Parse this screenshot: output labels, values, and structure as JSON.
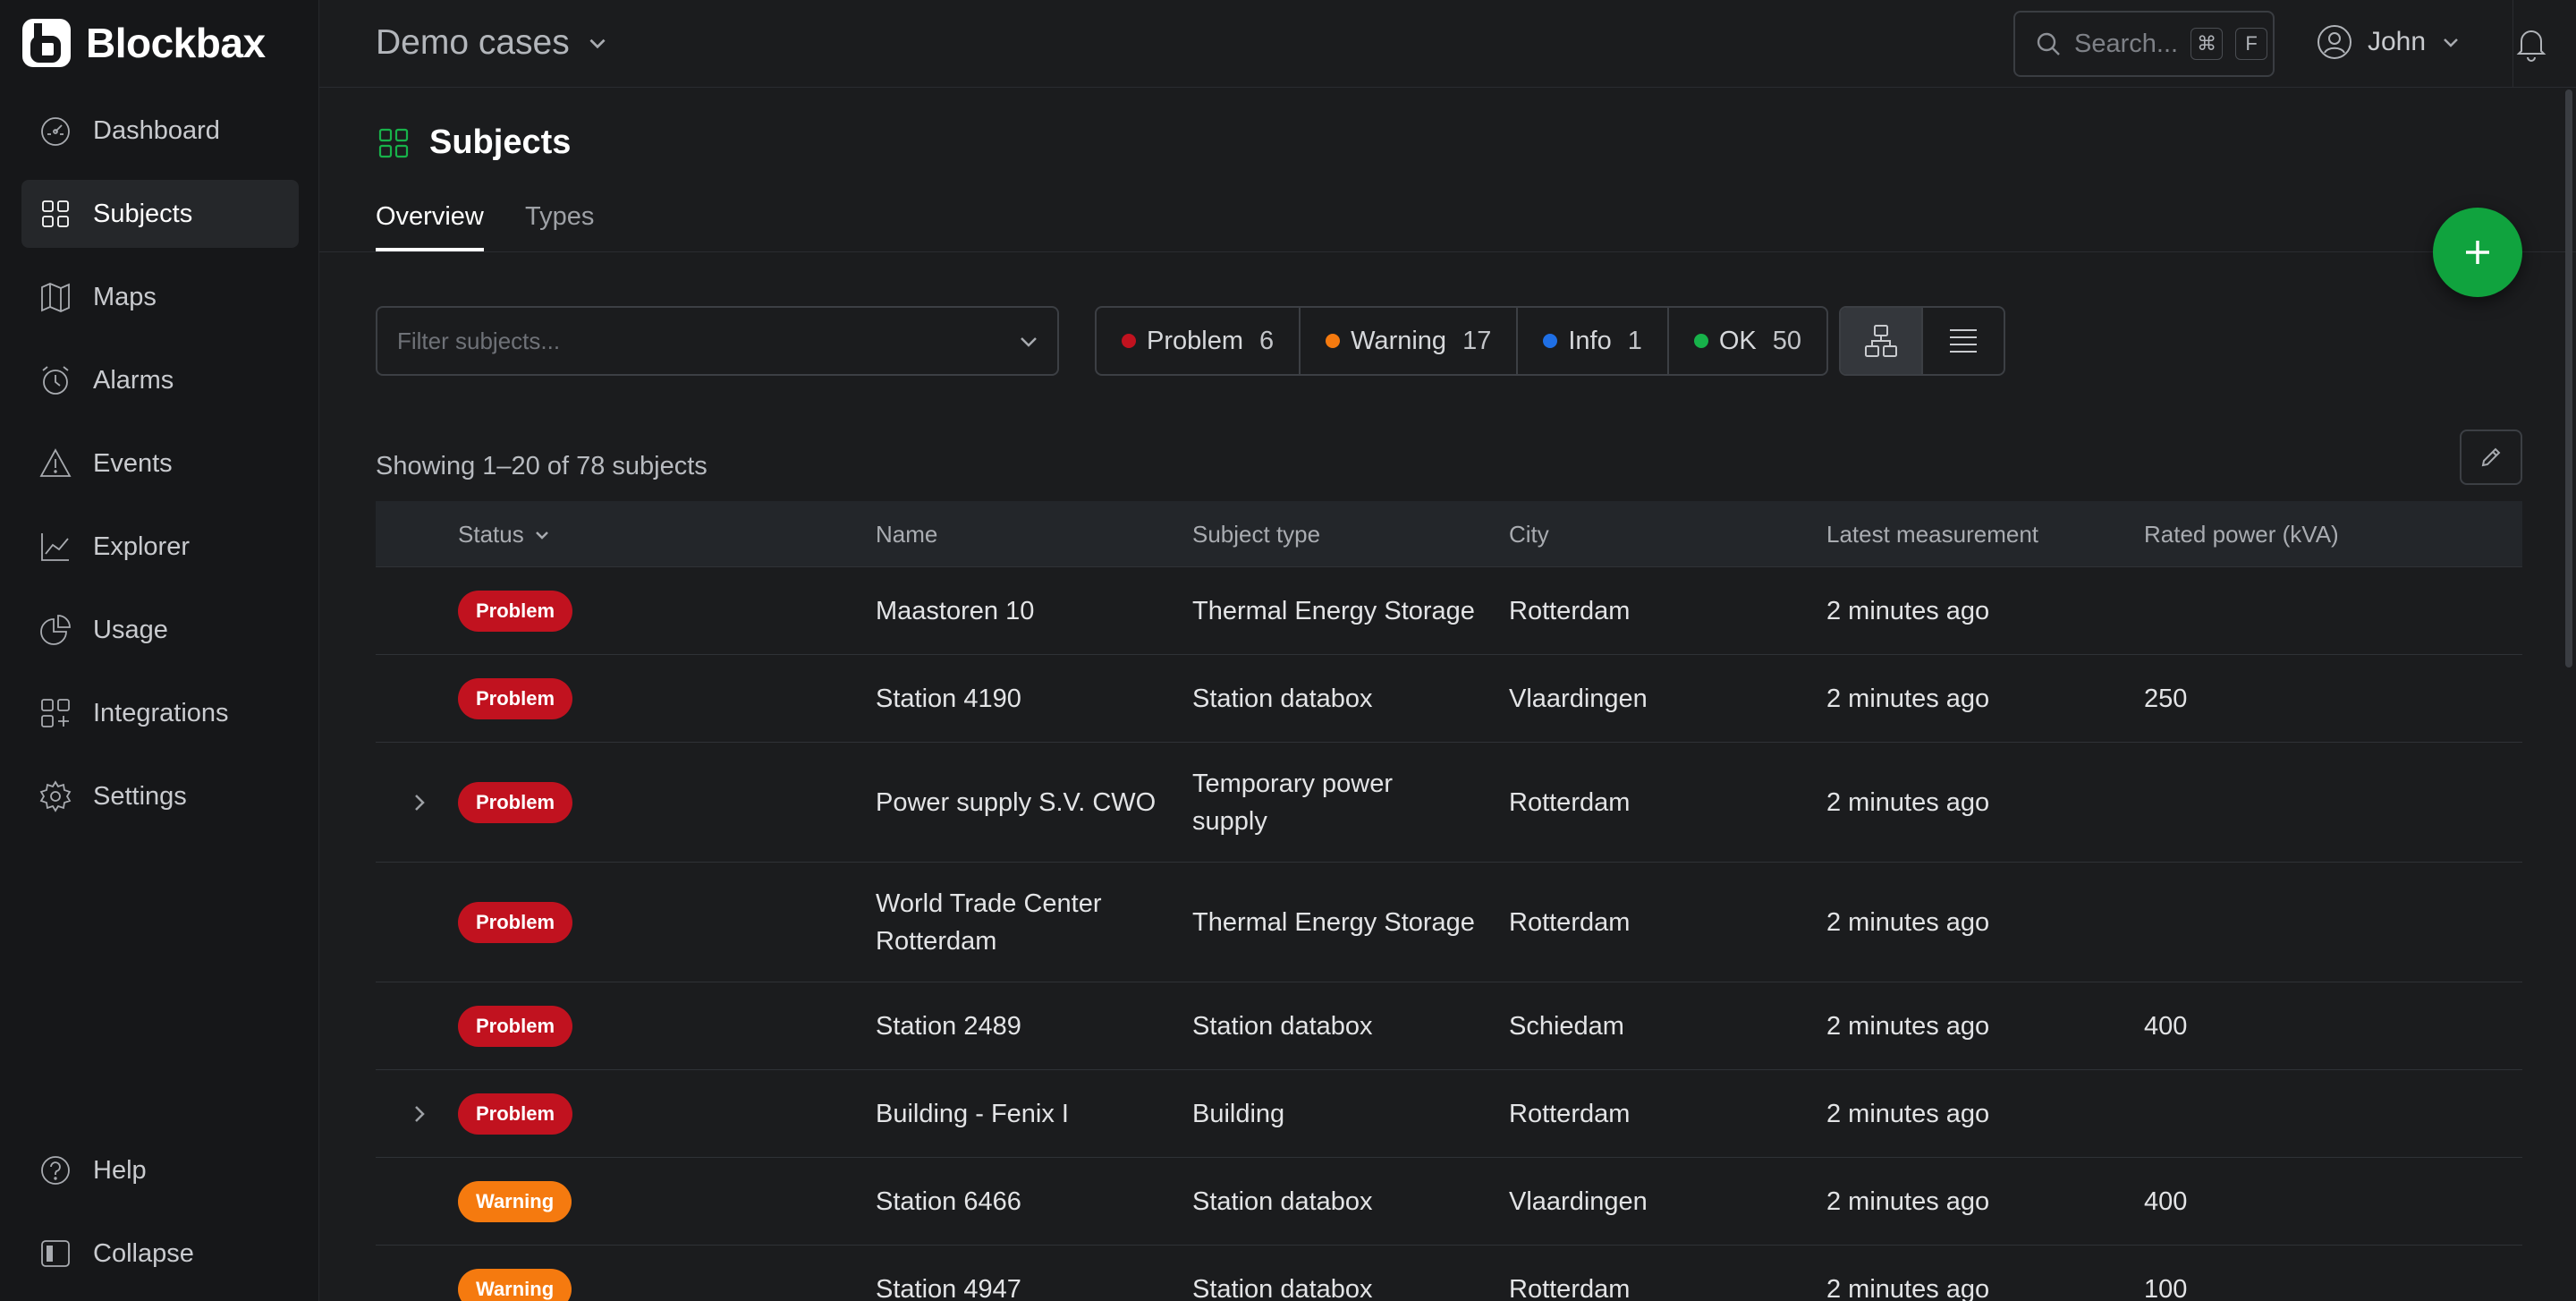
{
  "brand": {
    "name": "Blockbax"
  },
  "sidebar": {
    "items": [
      {
        "label": "Dashboard",
        "icon": "dashboard-icon",
        "active": false
      },
      {
        "label": "Subjects",
        "icon": "grid-icon",
        "active": true
      },
      {
        "label": "Maps",
        "icon": "map-icon",
        "active": false
      },
      {
        "label": "Alarms",
        "icon": "alarm-clock-icon",
        "active": false
      },
      {
        "label": "Events",
        "icon": "warning-triangle-icon",
        "active": false
      },
      {
        "label": "Explorer",
        "icon": "line-chart-icon",
        "active": false
      },
      {
        "label": "Usage",
        "icon": "pie-chart-icon",
        "active": false
      },
      {
        "label": "Integrations",
        "icon": "integrations-icon",
        "active": false
      },
      {
        "label": "Settings",
        "icon": "gear-icon",
        "active": false
      }
    ],
    "bottom": [
      {
        "label": "Help",
        "icon": "help-icon"
      },
      {
        "label": "Collapse",
        "icon": "collapse-icon"
      }
    ]
  },
  "header": {
    "workspace": "Demo cases",
    "search_placeholder": "Search...",
    "search_key1": "⌘",
    "search_key2": "F",
    "user": "John"
  },
  "page": {
    "title": "Subjects",
    "tabs": [
      "Overview",
      "Types"
    ],
    "filter_placeholder": "Filter subjects...",
    "status_counts": [
      {
        "label": "Problem",
        "count": "6",
        "color": "#c1121f"
      },
      {
        "label": "Warning",
        "count": "17",
        "color": "#f57a0f"
      },
      {
        "label": "Info",
        "count": "1",
        "color": "#1f6fe5"
      },
      {
        "label": "OK",
        "count": "50",
        "color": "#17b24a"
      }
    ],
    "showing": "Showing 1–20 of 78 subjects"
  },
  "table": {
    "columns": [
      "Status",
      "Name",
      "Subject type",
      "City",
      "Latest measurement",
      "Rated power (kVA)"
    ],
    "rows": [
      {
        "expandable": false,
        "status": "Problem",
        "name": [
          "Maastoren 10"
        ],
        "type": [
          "Thermal Energy Storage"
        ],
        "city": "Rotterdam",
        "latest": "2 minutes ago",
        "power": ""
      },
      {
        "expandable": false,
        "status": "Problem",
        "name": [
          "Station 4190"
        ],
        "type": [
          "Station databox"
        ],
        "city": "Vlaardingen",
        "latest": "2 minutes ago",
        "power": "250"
      },
      {
        "expandable": true,
        "status": "Problem",
        "name": [
          "Power supply S.V. CWO"
        ],
        "type": [
          "Temporary power",
          "supply"
        ],
        "city": "Rotterdam",
        "latest": "2 minutes ago",
        "power": ""
      },
      {
        "expandable": false,
        "status": "Problem",
        "name": [
          "World Trade Center",
          "Rotterdam"
        ],
        "type": [
          "Thermal Energy Storage"
        ],
        "city": "Rotterdam",
        "latest": "2 minutes ago",
        "power": ""
      },
      {
        "expandable": false,
        "status": "Problem",
        "name": [
          "Station 2489"
        ],
        "type": [
          "Station databox"
        ],
        "city": "Schiedam",
        "latest": "2 minutes ago",
        "power": "400"
      },
      {
        "expandable": true,
        "status": "Problem",
        "name": [
          "Building - Fenix I"
        ],
        "type": [
          "Building"
        ],
        "city": "Rotterdam",
        "latest": "2 minutes ago",
        "power": ""
      },
      {
        "expandable": false,
        "status": "Warning",
        "name": [
          "Station 6466"
        ],
        "type": [
          "Station databox"
        ],
        "city": "Vlaardingen",
        "latest": "2 minutes ago",
        "power": "400"
      },
      {
        "expandable": false,
        "status": "Warning",
        "name": [
          "Station 4947"
        ],
        "type": [
          "Station databox"
        ],
        "city": "Rotterdam",
        "latest": "2 minutes ago",
        "power": "100"
      }
    ]
  }
}
